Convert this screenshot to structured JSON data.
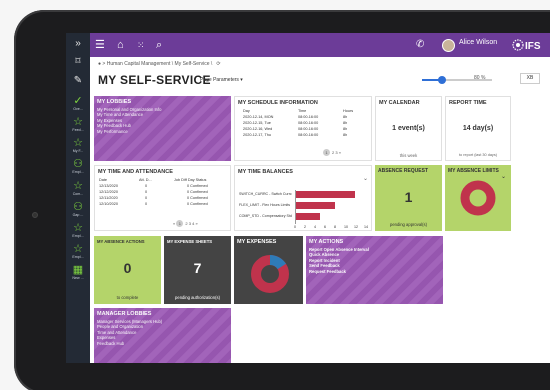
{
  "user": {
    "name": "Alice Wilson"
  },
  "brand": {
    "logo": "IFS"
  },
  "colors": {
    "top_bar": "#6c3c98",
    "tile_purple": "#9c5ab6",
    "tile_green": "#b4d46a",
    "tile_dark": "#444444",
    "rail": "#232a35",
    "accent": "#2f6fd6",
    "chart_red": "#c0334c"
  },
  "icons": {
    "home": "home-icon",
    "apps": "grid-icon",
    "search": "search-icon",
    "phone": "phone-icon",
    "menu": "hamburger-icon",
    "collapse": "double-chevron-icon",
    "bookmark": "bookmark-icon",
    "edit": "pencil-icon",
    "refresh": "refresh-icon"
  },
  "nav": {
    "breadcrumb": "Human Capital Management \\ My Self-Service \\",
    "items": [
      "Ove...",
      "Feed...",
      "My F...",
      "Empl...",
      "Com...",
      "Gap ...",
      "Empl...",
      "Empl...",
      "New ..."
    ]
  },
  "page": {
    "title": "MY SELF-SERVICE",
    "params": "Page Parameters ▾",
    "zoom": "80 %",
    "close": "XB"
  },
  "lobbies": {
    "title": "MY LOBBIES",
    "items": [
      "My Personal and Organization Info",
      "My Time and Attendance",
      "My Expenses",
      "My Feedback Hub",
      "My Performance"
    ]
  },
  "schedule": {
    "title": "MY SCHEDULE INFORMATION",
    "headers": [
      "Day",
      "Time",
      "Hours"
    ],
    "rows": [
      [
        "2020-12-14, MON",
        "08:00-16:00",
        "8h"
      ],
      [
        "2020-12-15, Tue",
        "08:00-16:00",
        "8h"
      ],
      [
        "2020-12-16, Wed",
        "08:00-16:00",
        "8h"
      ],
      [
        "2020-12-17, Thu",
        "08:00-16:00",
        "8h"
      ]
    ],
    "pages": [
      "1",
      "2",
      "3",
      "»"
    ]
  },
  "calendar": {
    "title": "MY CALENDAR",
    "value": "1 event(s)",
    "footer": "this week"
  },
  "report": {
    "title": "REPORT TIME",
    "value": "14 day(s)",
    "footer": "to report (last 30 days)"
  },
  "attendance": {
    "title": "MY TIME AND ATTENDANCE",
    "headers": [
      "Date",
      "Att. D...",
      "Job Diff Day Status"
    ],
    "rows": [
      [
        "12/13/2020",
        "0",
        "0 Confirmed"
      ],
      [
        "12/12/2020",
        "0",
        "0 Confirmed"
      ],
      [
        "12/11/2020",
        "0",
        "0 Confirmed"
      ],
      [
        "12/10/2020",
        "0",
        "0 Confirmed"
      ]
    ],
    "pages": [
      "«",
      "1",
      "2",
      "3",
      "4",
      "»"
    ]
  },
  "balances": {
    "title": "MY TIME BALANCES"
  },
  "chart_data": {
    "type": "bar",
    "title": "MY TIME BALANCES",
    "categories": [
      "SWITCH_CURRC - Switch Currc",
      "FLEX_LIMIT - Flex Hours Limits",
      "COMP_STD - Compensatory Std"
    ],
    "values": [
      12,
      8,
      5
    ],
    "ticks": [
      "0",
      "2",
      "4",
      "6",
      "8",
      "10",
      "12",
      "14"
    ],
    "xlim": [
      0,
      14
    ]
  },
  "absence_request": {
    "title": "ABSENCE REQUEST",
    "value": "1",
    "footer": "pending approval(s)"
  },
  "absence_limits": {
    "title": "MY ABSENCE LIMITS"
  },
  "absence_actions": {
    "title": "MY ABSENCE ACTIONS",
    "value": "0",
    "footer": "to complete"
  },
  "expense_sheets": {
    "title": "MY EXPENSE SHEETS",
    "value": "7",
    "footer": "pending authorization(s)"
  },
  "expenses": {
    "title": "MY EXPENSES"
  },
  "actions": {
    "title": "MY ACTIONS",
    "items": [
      "Report Open Absence Interval",
      "Quick Absence",
      "Report Incident",
      "Send Feedback",
      "Request Feedback"
    ]
  },
  "manager": {
    "title": "MANAGER LOBBIES",
    "items": [
      "Manager Services (Managers Hub)",
      "People and Organization",
      "Time and Attendance",
      "Expenses",
      "Feedback Hub"
    ]
  }
}
